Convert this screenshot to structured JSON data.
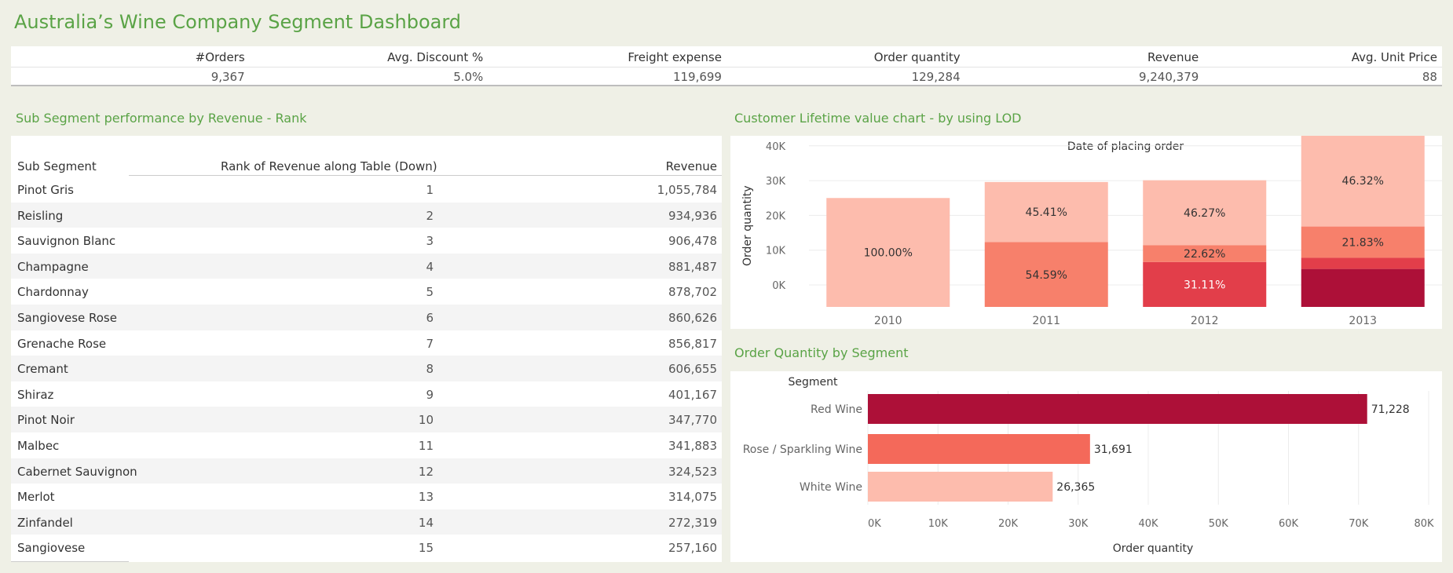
{
  "dashboard": {
    "title": "Australia’s Wine Company Segment Dashboard"
  },
  "kpis": [
    {
      "label": "#Orders",
      "value": "9,367"
    },
    {
      "label": "Avg. Discount %",
      "value": "5.0%"
    },
    {
      "label": "Freight expense",
      "value": "119,699"
    },
    {
      "label": "Order quantity",
      "value": "129,284"
    },
    {
      "label": "Revenue",
      "value": "9,240,379"
    },
    {
      "label": "Avg. Unit Price",
      "value": "88"
    }
  ],
  "sections": {
    "table_title": "Sub Segment performance by Revenue - Rank",
    "clv_title": "Customer Lifetime value chart - by using LOD",
    "segment_title": "Order Quantity by Segment"
  },
  "table": {
    "columns": [
      "Sub Segment",
      "Rank of Revenue along Table (Down)",
      "Revenue"
    ],
    "rows": [
      {
        "name": "Pinot Gris",
        "rank": "1",
        "revenue": "1,055,784"
      },
      {
        "name": "Reisling",
        "rank": "2",
        "revenue": "934,936"
      },
      {
        "name": "Sauvignon Blanc",
        "rank": "3",
        "revenue": "906,478"
      },
      {
        "name": "Champagne",
        "rank": "4",
        "revenue": "881,487"
      },
      {
        "name": "Chardonnay",
        "rank": "5",
        "revenue": "878,702"
      },
      {
        "name": "Sangiovese Rose",
        "rank": "6",
        "revenue": "860,626"
      },
      {
        "name": "Grenache Rose",
        "rank": "7",
        "revenue": "856,817"
      },
      {
        "name": "Cremant",
        "rank": "8",
        "revenue": "606,655"
      },
      {
        "name": "Shiraz",
        "rank": "9",
        "revenue": "401,167"
      },
      {
        "name": "Pinot Noir",
        "rank": "10",
        "revenue": "347,770"
      },
      {
        "name": "Malbec",
        "rank": "11",
        "revenue": "341,883"
      },
      {
        "name": "Cabernet Sauvignon",
        "rank": "12",
        "revenue": "324,523"
      },
      {
        "name": "Merlot",
        "rank": "13",
        "revenue": "314,075"
      },
      {
        "name": "Zinfandel",
        "rank": "14",
        "revenue": "272,319"
      },
      {
        "name": "Sangiovese",
        "rank": "15",
        "revenue": "257,160"
      }
    ]
  },
  "chart_data": [
    {
      "type": "bar",
      "stacked": true,
      "title": "Date of placing order",
      "xlabel": "",
      "ylabel": "Order quantity",
      "categories": [
        "2010",
        "2011",
        "2012",
        "2013"
      ],
      "yticks": [
        "0K",
        "10K",
        "20K",
        "30K",
        "40K"
      ],
      "ylim": [
        -2500,
        42000
      ],
      "grid": true,
      "series": [
        {
          "color": "#ad1038",
          "values": [
            0,
            0,
            0,
            4600
          ]
        },
        {
          "color": "#e23e4a",
          "values": [
            0,
            0,
            6600,
            3200
          ]
        },
        {
          "color": "#f7806b",
          "values": [
            0,
            12300,
            4800,
            9000
          ]
        },
        {
          "color": "#fdbcad",
          "values": [
            25000,
            17300,
            18700,
            26500
          ]
        }
      ],
      "labels": [
        {
          "category": "2010",
          "series": 3,
          "text": "100.00%",
          "color": "#333333"
        },
        {
          "category": "2011",
          "series": 2,
          "text": "54.59%",
          "color": "#333333"
        },
        {
          "category": "2011",
          "series": 3,
          "text": "45.41%",
          "color": "#333333"
        },
        {
          "category": "2012",
          "series": 1,
          "text": "31.11%",
          "color": "#ffffff"
        },
        {
          "category": "2012",
          "series": 2,
          "text": "22.62%",
          "color": "#333333"
        },
        {
          "category": "2012",
          "series": 3,
          "text": "46.27%",
          "color": "#333333"
        },
        {
          "category": "2013",
          "series": 2,
          "text": "21.83%",
          "color": "#333333"
        },
        {
          "category": "2013",
          "series": 3,
          "text": "46.32%",
          "color": "#333333"
        }
      ]
    },
    {
      "type": "bar",
      "orientation": "horizontal",
      "title": "",
      "category_header": "Segment",
      "xlabel": "Order quantity",
      "categories": [
        "Red Wine",
        "Rose / Sparkling Wine",
        "White Wine"
      ],
      "values": [
        71228,
        31691,
        26365
      ],
      "value_labels": [
        "71,228",
        "31,691",
        "26,365"
      ],
      "colors": [
        "#ad1038",
        "#f4695a",
        "#fdbcad"
      ],
      "xticks": [
        "0K",
        "10K",
        "20K",
        "30K",
        "40K",
        "50K",
        "60K",
        "70K",
        "80K"
      ],
      "xlim": [
        0,
        80000
      ],
      "grid": true
    }
  ]
}
